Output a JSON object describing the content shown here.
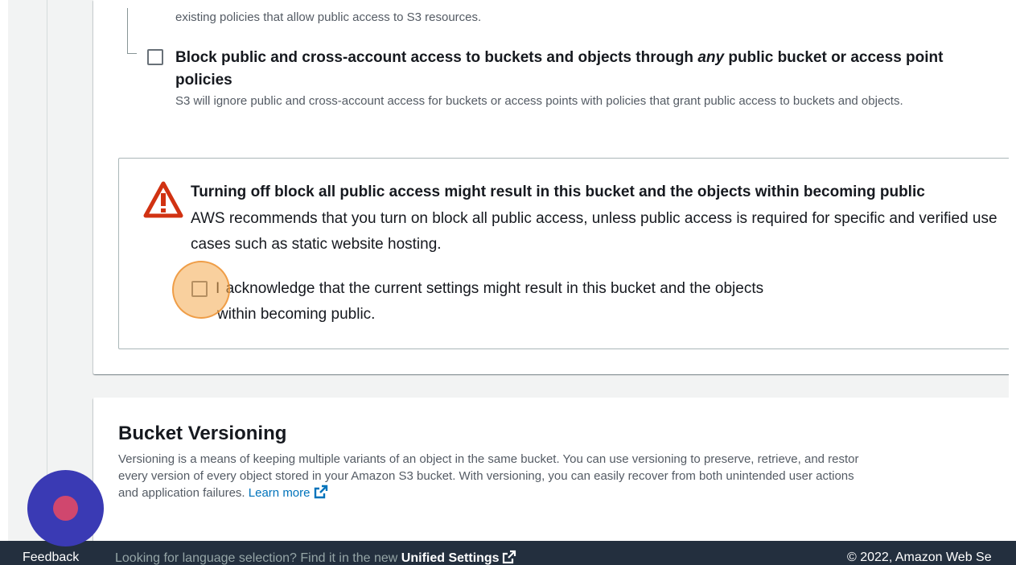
{
  "block_options": {
    "prev_desc_tail": "existing policies that allow public access to S3 resources.",
    "option4": {
      "title_before": "Block public and cross-account access to buckets and objects through ",
      "title_em": "any",
      "title_after": " public bucket or access point policies",
      "description": "S3 will ignore public and cross-account access for buckets or access points with policies that grant public access to buckets and objects.",
      "checked": false
    }
  },
  "warning": {
    "title": "Turning off block all public access might result in this bucket and the objects within becoming public",
    "body": "AWS recommends that you turn on block all public access, unless public access is required for specific and verified use cases such as static website hosting.",
    "ack_prefix": "I",
    "ack_label": "acknowledge that the current settings might result in this bucket and the objects within becoming public.",
    "ack_checked": false,
    "icon": "warning-triangle-icon",
    "icon_color": "#d13212"
  },
  "versioning": {
    "title": "Bucket Versioning",
    "desc_line1": "Versioning is a means of keeping multiple variants of an object in the same bucket. You can use versioning to preserve, retrieve, and restor",
    "desc_line2": "every version of every object stored in your Amazon S3 bucket. With versioning, you can easily recover from both unintended user actions",
    "desc_line3": "and application failures.",
    "learn_more": "Learn more"
  },
  "footer": {
    "feedback": "Feedback",
    "lang_note": "Looking for language selection? Find it in the new ",
    "unified_settings": "Unified Settings",
    "copyright": "© 2022, Amazon Web Se"
  },
  "colors": {
    "link": "#0073bb",
    "footer_bg": "#232f3e",
    "fab": "#3a3ab4",
    "highlight": "#f4a94e"
  }
}
